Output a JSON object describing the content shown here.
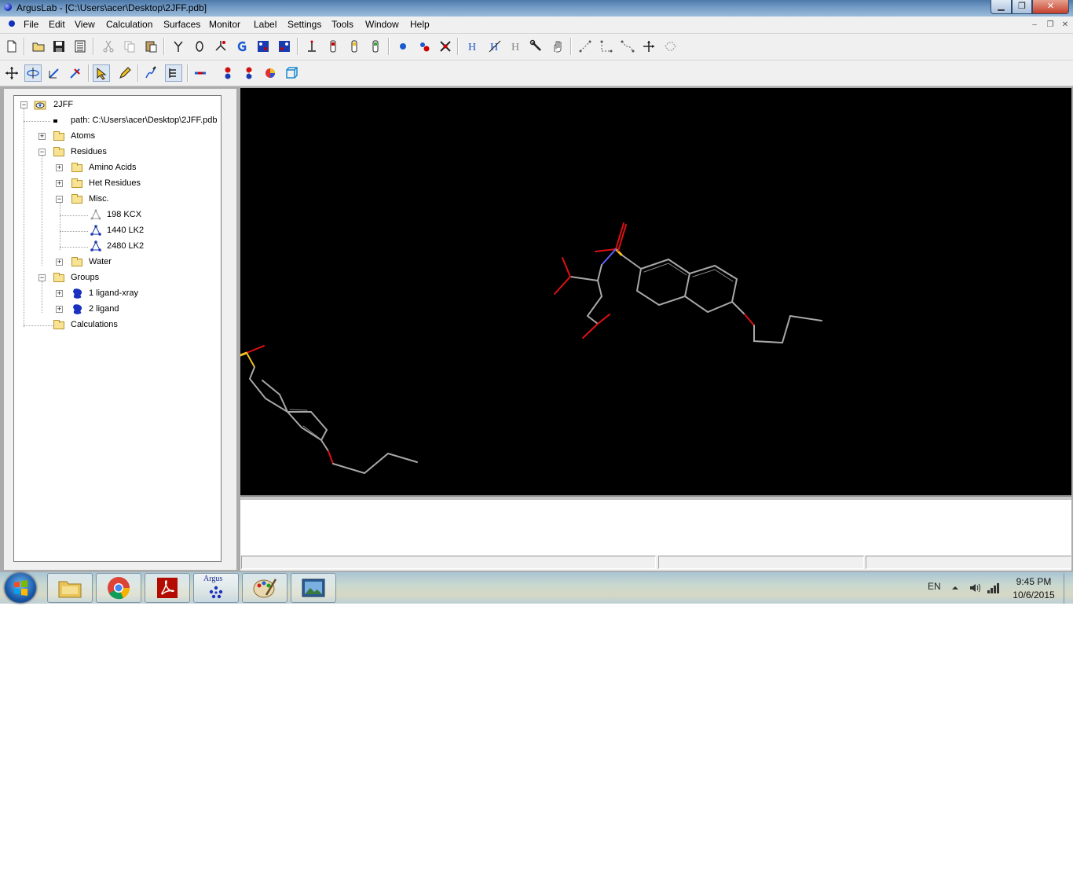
{
  "window": {
    "title": "ArgusLab - [C:\\Users\\acer\\Desktop\\2JFF.pdb]",
    "minimize_glyph": "▁",
    "maximize_glyph": "❐",
    "close_glyph": "✕"
  },
  "menu": {
    "items": [
      "File",
      "Edit",
      "View",
      "Calculation",
      "Surfaces",
      "Monitor",
      "Label",
      "Settings",
      "Tools",
      "Window",
      "Help"
    ],
    "mdi_minimize": "–",
    "mdi_restore": "❐",
    "mdi_close": "✕"
  },
  "toolbar1": {
    "icons": [
      "new-file-icon",
      "open-folder-icon",
      "save-icon",
      "print-list-icon",
      "cut-icon",
      "copy-icon",
      "paste-icon",
      "y-bond-icon",
      "ring-icon",
      "arrow-bond-icon",
      "g-icon",
      "molecule-a-icon",
      "molecule-b-icon",
      "dipole-icon",
      "orbital-a-icon",
      "orbital-b-icon",
      "orbital-c-icon",
      "atom-icon",
      "remove-atom-icon",
      "delete-icon",
      "add-hydrogen-icon",
      "hydrogen-edit-icon",
      "hydrogen-gray-icon",
      "wrench-icon",
      "hand-icon",
      "measure-distance-icon",
      "measure-angle-icon",
      "measure-dihedral-icon",
      "axes-icon",
      "fragment-icon"
    ]
  },
  "toolbar2": {
    "icons": [
      "translate-icon",
      "rotate-icon",
      "scale-icon",
      "zoom-icon",
      "select-arrow-icon",
      "pencil-icon",
      "draw-bond-icon",
      "tree-view-icon",
      "ball-stick-icon",
      "ball-red-icon",
      "ball-multi-icon",
      "sphere-color-icon",
      "box-icon"
    ]
  },
  "tree": {
    "root": "2JFF",
    "path": "path: C:\\Users\\acer\\Desktop\\2JFF.pdb",
    "atoms": "Atoms",
    "residues": "Residues",
    "amino_acids": "Amino Acids",
    "het_residues": "Het Residues",
    "misc": "Misc.",
    "misc_items": [
      "198 KCX",
      "1440 LK2",
      "2480 LK2"
    ],
    "water": "Water",
    "groups": "Groups",
    "group_items": [
      "1 ligand-xray",
      "2 ligand"
    ],
    "calculations": "Calculations",
    "expand_plus": "+",
    "expand_minus": "−"
  },
  "colors": {
    "viewport_background": "#000000",
    "carbon": "#a8a8a8",
    "oxygen": "#e01010",
    "sulfur": "#f0c020",
    "nitrogen": "#6060ff"
  },
  "taskbar": {
    "apps": [
      "file-explorer-icon",
      "chrome-icon",
      "acrobat-icon",
      "arguslab-icon",
      "paint-icon",
      "photo-viewer-icon"
    ],
    "argus_label": "Argus",
    "language": "EN",
    "time": "9:45 PM",
    "date": "10/6/2015"
  }
}
